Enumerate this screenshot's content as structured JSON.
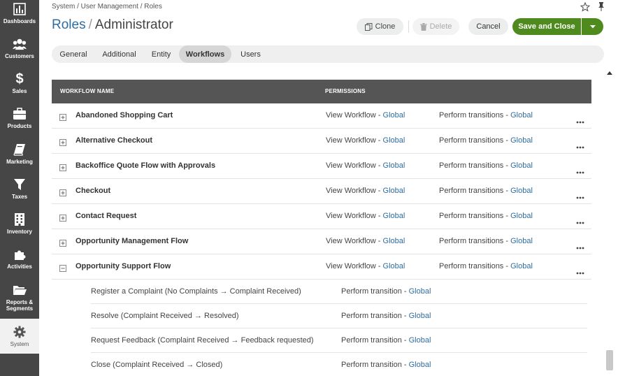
{
  "sidebar": {
    "items": [
      {
        "label": "Dashboards",
        "icon": "dashboards-icon"
      },
      {
        "label": "Customers",
        "icon": "customers-icon"
      },
      {
        "label": "Sales",
        "icon": "dollar-icon"
      },
      {
        "label": "Products",
        "icon": "briefcase-icon"
      },
      {
        "label": "Marketing",
        "icon": "book-icon"
      },
      {
        "label": "Taxes",
        "icon": "filter-icon"
      },
      {
        "label": "Inventory",
        "icon": "building-icon"
      },
      {
        "label": "Activities",
        "icon": "puzzle-icon"
      },
      {
        "label": "Reports &",
        "label2": "Segments",
        "icon": "folder-icon"
      },
      {
        "label": "System",
        "icon": "gear-icon",
        "active": true
      }
    ]
  },
  "header": {
    "breadcrumb": "System / User Management / Roles",
    "title_entity": "Roles",
    "title_separator": "/",
    "title_record": "Administrator"
  },
  "actions": {
    "clone": "Clone",
    "delete": "Delete",
    "cancel": "Cancel",
    "save": "Save and Close"
  },
  "tabs": [
    {
      "label": "General"
    },
    {
      "label": "Additional"
    },
    {
      "label": "Entity"
    },
    {
      "label": "Workflows",
      "active": true
    },
    {
      "label": "Users"
    }
  ],
  "table": {
    "columns": {
      "name": "WORKFLOW NAME",
      "permissions": "PERMISSIONS"
    },
    "rows": [
      {
        "name": "Abandoned Shopping Cart",
        "view": "View Workflow - ",
        "view_level": "Global",
        "perform": "Perform transitions - ",
        "perform_level": "Global"
      },
      {
        "name": "Alternative Checkout",
        "view": "View Workflow - ",
        "view_level": "Global",
        "perform": "Perform transitions - ",
        "perform_level": "Global"
      },
      {
        "name": "Backoffice Quote Flow with Approvals",
        "view": "View Workflow - ",
        "view_level": "Global",
        "perform": "Perform transitions - ",
        "perform_level": "Global"
      },
      {
        "name": "Checkout",
        "view": "View Workflow - ",
        "view_level": "Global",
        "perform": "Perform transitions - ",
        "perform_level": "Global"
      },
      {
        "name": "Contact Request",
        "view": "View Workflow - ",
        "view_level": "Global",
        "perform": "Perform transitions - ",
        "perform_level": "Global"
      },
      {
        "name": "Opportunity Management Flow",
        "view": "View Workflow - ",
        "view_level": "Global",
        "perform": "Perform transitions - ",
        "perform_level": "Global"
      },
      {
        "name": "Opportunity Support Flow",
        "view": "View Workflow - ",
        "view_level": "Global",
        "perform": "Perform transitions - ",
        "perform_level": "Global",
        "expanded": true
      }
    ],
    "transitions": [
      {
        "name": "Register a Complaint (No Complaints → Complaint Received)",
        "perm": "Perform transition - ",
        "level": "Global"
      },
      {
        "name": "Resolve (Complaint Received → Resolved)",
        "perm": "Perform transition - ",
        "level": "Global"
      },
      {
        "name": "Request Feedback (Complaint Received → Feedback requested)",
        "perm": "Perform transition - ",
        "level": "Global"
      },
      {
        "name": "Close (Complaint Received → Closed)",
        "perm": "Perform transition - ",
        "level": "Global"
      }
    ]
  }
}
